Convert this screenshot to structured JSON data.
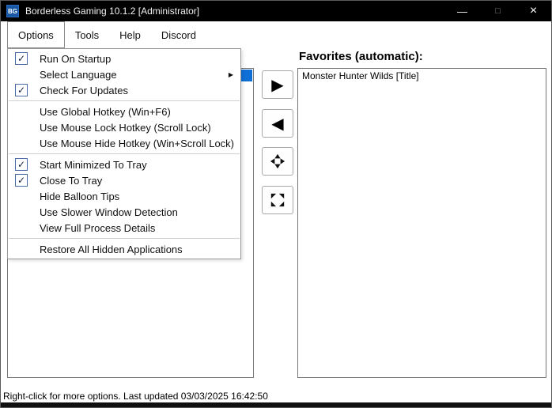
{
  "window": {
    "title": "Borderless Gaming 10.1.2 [Administrator]",
    "icon_label": "BG",
    "controls": {
      "minimize_icon": "—",
      "maximize_icon": "□",
      "close_icon": "×"
    }
  },
  "menubar": {
    "items": [
      "Options",
      "Tools",
      "Help",
      "Discord"
    ]
  },
  "options_menu": {
    "check_icon": "✓",
    "submenu_arrow_icon": "▶",
    "items": [
      {
        "label": "Run On Startup",
        "checked": true
      },
      {
        "label": "Select Language",
        "has_submenu": true
      },
      {
        "label": "Check For Updates",
        "checked": true
      },
      {
        "label": "Use Global Hotkey (Win+F6)"
      },
      {
        "label": "Use Mouse Lock Hotkey (Scroll Lock)"
      },
      {
        "label": "Use Mouse Hide Hotkey (Win+Scroll Lock)"
      },
      {
        "label": "Start Minimized To Tray",
        "checked": true
      },
      {
        "label": "Close To Tray",
        "checked": true
      },
      {
        "label": "Hide Balloon Tips"
      },
      {
        "label": "Use Slower Window Detection"
      },
      {
        "label": "View Full Process Details"
      },
      {
        "label": "Restore All Hidden Applications"
      }
    ]
  },
  "transfer_buttons": {
    "add_icon": "▶",
    "remove_icon": "◀"
  },
  "favorites": {
    "header": "Favorites (automatic):",
    "items": [
      "Monster Hunter Wilds [Title]"
    ]
  },
  "statusbar": {
    "text": "Right-click for more options. Last updated 03/03/2025 16:42:50"
  },
  "colors": {
    "titlebar": "#000000",
    "app_icon": "#1857a4",
    "selection": "#0f6fd7",
    "checkbox_border": "#4a69a8"
  }
}
